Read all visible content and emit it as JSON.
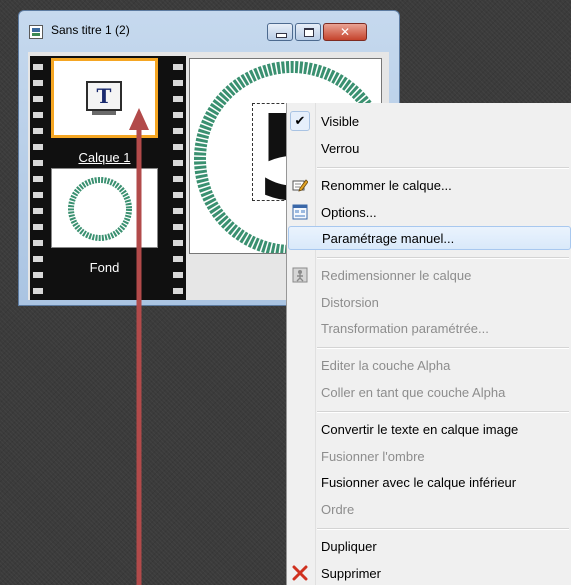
{
  "window": {
    "title": "Sans titre 1 (2)",
    "buttons": {
      "minimize_icon": "minimize-icon",
      "maximize_icon": "maximize-icon",
      "close_icon": "close-icon",
      "close_glyph": "✕"
    }
  },
  "layers": [
    {
      "name": "Calque 1",
      "icon": "text-layer-icon",
      "thumb_glyph": "T",
      "selected": true
    },
    {
      "name": "Fond",
      "icon": "ring-thumbnail",
      "selected": false
    }
  ],
  "canvas": {
    "sign_glyph": "5",
    "ring_color": "#3a9070"
  },
  "context_menu": {
    "items": [
      {
        "label": "Visible",
        "checked": true,
        "enabled": true,
        "check_glyph": "✔"
      },
      {
        "label": "Verrou",
        "enabled": true
      },
      {
        "label": "Renommer le calque...",
        "icon": "rename-pencil-icon",
        "enabled": true
      },
      {
        "label": "Options...",
        "icon": "options-dialog-icon",
        "enabled": true
      },
      {
        "label": "Paramétrage manuel...",
        "enabled": true,
        "highlighted": true
      },
      {
        "label": "Redimensionner le calque",
        "icon": "resize-icon",
        "enabled": false
      },
      {
        "label": "Distorsion",
        "enabled": false
      },
      {
        "label": "Transformation paramétrée...",
        "enabled": false
      },
      {
        "label": "Editer la couche Alpha",
        "enabled": false
      },
      {
        "label": "Coller en tant que couche Alpha",
        "enabled": false
      },
      {
        "label": "Convertir le texte en calque image",
        "enabled": true
      },
      {
        "label": "Fusionner l'ombre",
        "enabled": false
      },
      {
        "label": "Fusionner avec le calque inférieur",
        "enabled": true
      },
      {
        "label": "Ordre",
        "enabled": false
      },
      {
        "label": "Dupliquer",
        "enabled": true
      },
      {
        "label": "Supprimer",
        "icon": "delete-x-icon",
        "enabled": true
      }
    ]
  },
  "colors": {
    "highlight": "#d9e9fa",
    "selection": "#f5a623",
    "arrow": "#b24a4a",
    "delete": "#d0311f"
  }
}
